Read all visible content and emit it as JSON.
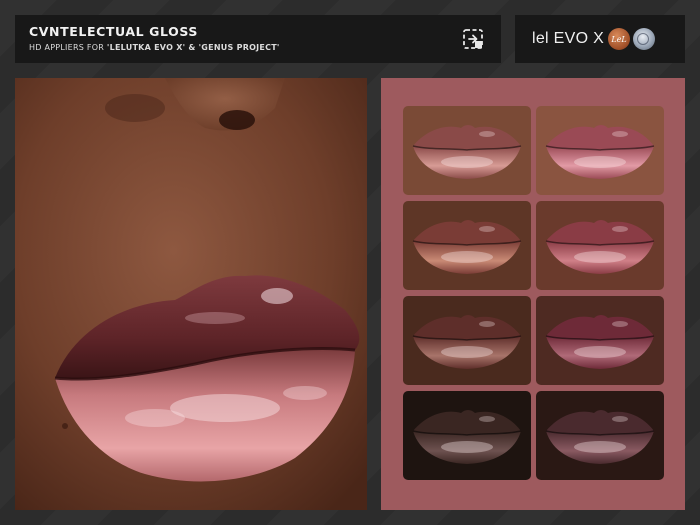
{
  "header": {
    "title": "CVNTELECTUAL GLOSS",
    "subtitle_prefix": "HD APPLIERS FOR ",
    "subtitle_bold": "'LELUTKA EVO X' & 'GENUS PROJECT'",
    "icon": "appliers-icon"
  },
  "brand": {
    "text": "lel EVO X",
    "logo_lel_text": "LeL",
    "logos": [
      "lelutka-logo",
      "genus-logo"
    ]
  },
  "colors": {
    "panel_background": "#9e5a5e",
    "header_background": "#181818",
    "page_background": "#2d2d2d"
  },
  "swatches": [
    {
      "skin": "#7a4a36",
      "upper": "#8a4a48",
      "lower": "#d79b95"
    },
    {
      "skin": "#8a5440",
      "upper": "#9a4a55",
      "lower": "#e29aa5"
    },
    {
      "skin": "#5e3626",
      "upper": "#7a3c36",
      "lower": "#c98a75"
    },
    {
      "skin": "#6a3a2c",
      "upper": "#8a3c45",
      "lower": "#d08088"
    },
    {
      "skin": "#4a2a1e",
      "upper": "#5e2e2a",
      "lower": "#a8746a"
    },
    {
      "skin": "#4e2a22",
      "upper": "#6e2a38",
      "lower": "#b06a78"
    },
    {
      "skin": "#1e1410",
      "upper": "#3a2622",
      "lower": "#6e5250"
    },
    {
      "skin": "#2a1814",
      "upper": "#4a2a2e",
      "lower": "#8a5a62"
    }
  ]
}
